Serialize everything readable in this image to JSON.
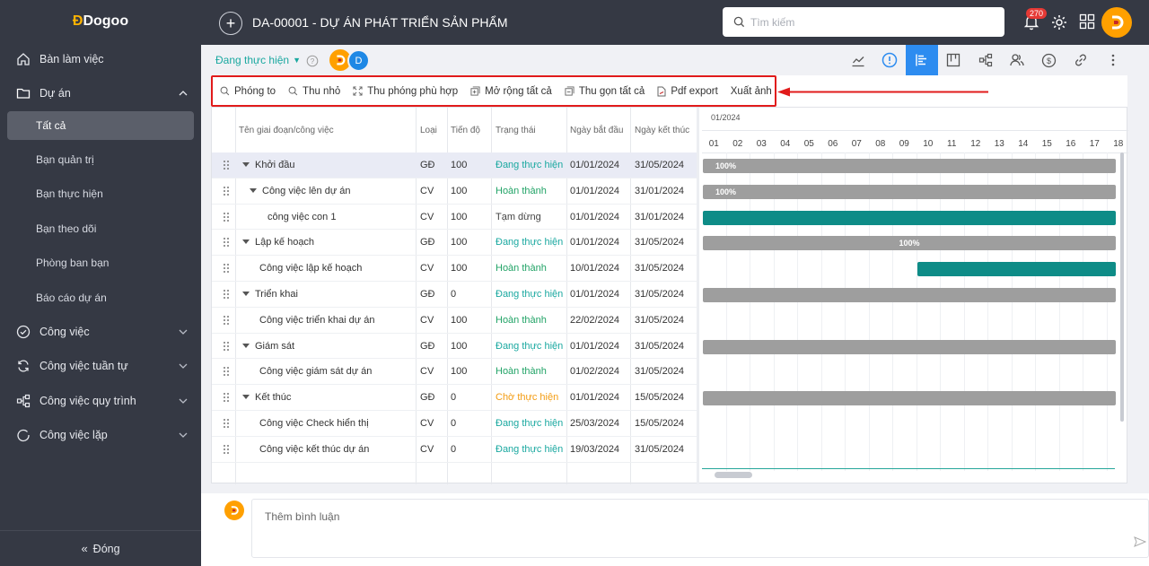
{
  "brand": {
    "logo_text": "Dogoo"
  },
  "sidebar": {
    "items": [
      {
        "label": "Bàn làm việc"
      },
      {
        "label": "Dự án"
      },
      {
        "label": "Tất cả"
      },
      {
        "label": "Bạn quản trị"
      },
      {
        "label": "Bạn thực hiện"
      },
      {
        "label": "Bạn theo dõi"
      },
      {
        "label": "Phòng ban bạn"
      },
      {
        "label": "Báo cáo dự án"
      },
      {
        "label": "Công việc"
      },
      {
        "label": "Công việc tuần tự"
      },
      {
        "label": "Công việc quy trình"
      },
      {
        "label": "Công việc lặp"
      }
    ],
    "close_label": "Đóng"
  },
  "header": {
    "title": "DA-00001 - DỰ ÁN PHÁT TRIỂN SẢN PHẨM",
    "search_placeholder": "Tìm kiếm",
    "notification_count": "270"
  },
  "project": {
    "status": "Đang thực hiện",
    "member_initial": "D"
  },
  "toolbar": {
    "zoom_in": "Phóng to",
    "zoom_out": "Thu nhỏ",
    "zoom_fit": "Thu phóng phù hợp",
    "expand_all": "Mở rộng tất cả",
    "collapse_all": "Thu gọn tất cả",
    "pdf_export": "Pdf export",
    "export_image": "Xuất ảnh"
  },
  "table": {
    "columns": {
      "name": "Tên giai đoạn/công việc",
      "type": "Loại",
      "progress": "Tiến độ",
      "status": "Trạng thái",
      "start": "Ngày bắt đầu",
      "end": "Ngày kết thúc"
    },
    "rows": [
      {
        "name": "Khởi đầu",
        "type": "GĐ",
        "progress": "100",
        "status": "Đang thực hiện",
        "start": "01/01/2024",
        "end": "31/05/2024"
      },
      {
        "name": "Công việc lên dự án",
        "type": "CV",
        "progress": "100",
        "status": "Hoàn thành",
        "start": "01/01/2024",
        "end": "31/01/2024"
      },
      {
        "name": "công việc con 1",
        "type": "CV",
        "progress": "100",
        "status": "Tạm dừng",
        "start": "01/01/2024",
        "end": "31/01/2024"
      },
      {
        "name": "Lập kế hoạch",
        "type": "GĐ",
        "progress": "100",
        "status": "Đang thực hiện",
        "start": "01/01/2024",
        "end": "31/05/2024"
      },
      {
        "name": "Công việc lập kế hoạch",
        "type": "CV",
        "progress": "100",
        "status": "Hoàn thành",
        "start": "10/01/2024",
        "end": "31/05/2024"
      },
      {
        "name": "Triển khai",
        "type": "GĐ",
        "progress": "0",
        "status": "Đang thực hiện",
        "start": "01/01/2024",
        "end": "31/05/2024"
      },
      {
        "name": "Công việc triển khai dự án",
        "type": "CV",
        "progress": "100",
        "status": "Hoàn thành",
        "start": "22/02/2024",
        "end": "31/05/2024"
      },
      {
        "name": "Giám sát",
        "type": "GĐ",
        "progress": "100",
        "status": "Đang thực hiện",
        "start": "01/01/2024",
        "end": "31/05/2024"
      },
      {
        "name": "Công việc giám sát dự án",
        "type": "CV",
        "progress": "100",
        "status": "Hoàn thành",
        "start": "01/02/2024",
        "end": "31/05/2024"
      },
      {
        "name": "Kết thúc",
        "type": "GĐ",
        "progress": "0",
        "status": "Chờ thực hiện",
        "start": "01/01/2024",
        "end": "15/05/2024"
      },
      {
        "name": "Công việc Check hiển thị",
        "type": "CV",
        "progress": "0",
        "status": "Đang thực hiện",
        "start": "25/03/2024",
        "end": "15/05/2024"
      },
      {
        "name": "Công việc kết thúc dự án",
        "type": "CV",
        "progress": "0",
        "status": "Đang thực hiện",
        "start": "19/03/2024",
        "end": "31/05/2024"
      }
    ]
  },
  "gantt": {
    "month": "01/2024",
    "days": [
      "01",
      "02",
      "03",
      "04",
      "05",
      "06",
      "07",
      "08",
      "09",
      "10",
      "11",
      "12",
      "13",
      "14",
      "15",
      "16",
      "17",
      "18"
    ],
    "bar_labels": [
      "100%",
      "100%",
      "",
      "100%",
      "",
      "",
      "",
      "",
      "",
      "",
      "",
      ""
    ]
  },
  "comment": {
    "placeholder": "Thêm bình luận"
  },
  "colors": {
    "sidebar_bg": "#353944",
    "accent_blue": "#2d8cf0",
    "status_in_progress": "#1aa8a0",
    "status_done": "#21a366",
    "status_waiting": "#f39c12",
    "bar_grey": "#9e9e9e",
    "bar_teal": "#0e8c87",
    "highlight_red": "#e11b1b"
  }
}
